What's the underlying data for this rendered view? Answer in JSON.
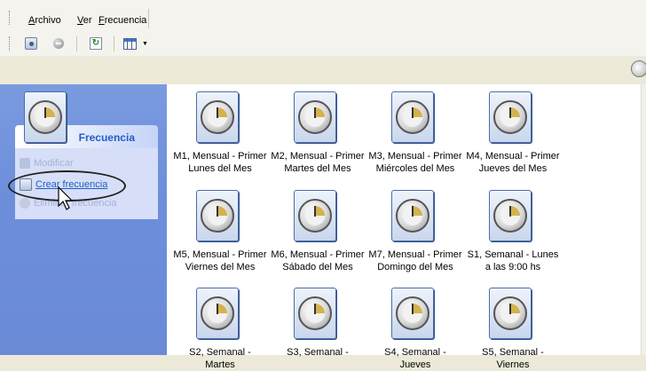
{
  "menubar": {
    "items": [
      "Archivo",
      "Ver",
      "Frecuencia"
    ]
  },
  "toolbar": {
    "buttons": [
      "schedule-icon",
      "cancel-icon",
      "refresh-icon",
      "view-grid-icon"
    ]
  },
  "task_panel": {
    "title": "Frecuencia",
    "items": [
      {
        "label": "Modificar",
        "enabled": false
      },
      {
        "label": "Crear frecuencia",
        "enabled": true
      },
      {
        "label": "Eliminar frecuencia",
        "enabled": false
      }
    ]
  },
  "tiles": [
    {
      "label": "M1, Mensual - Primer Lunes del Mes"
    },
    {
      "label": "M2, Mensual - Primer Martes del Mes"
    },
    {
      "label": "M3, Mensual - Primer Miércoles del Mes"
    },
    {
      "label": "M4, Mensual - Primer Jueves del Mes"
    },
    {
      "label": "M5, Mensual - Primer Viernes del Mes"
    },
    {
      "label": "M6, Mensual - Primer Sábado del Mes"
    },
    {
      "label": "M7, Mensual - Primer Domingo del Mes"
    },
    {
      "label": "S1, Semanal - Lunes a las 9:00 hs"
    },
    {
      "label": "S2, Semanal - Martes"
    },
    {
      "label": "S3, Semanal -"
    },
    {
      "label": "S4, Semanal - Jueves"
    },
    {
      "label": "S5, Semanal - Viernes"
    }
  ],
  "colors": {
    "task_title": "#215dc6",
    "left_panel": "#6d8fdb"
  }
}
